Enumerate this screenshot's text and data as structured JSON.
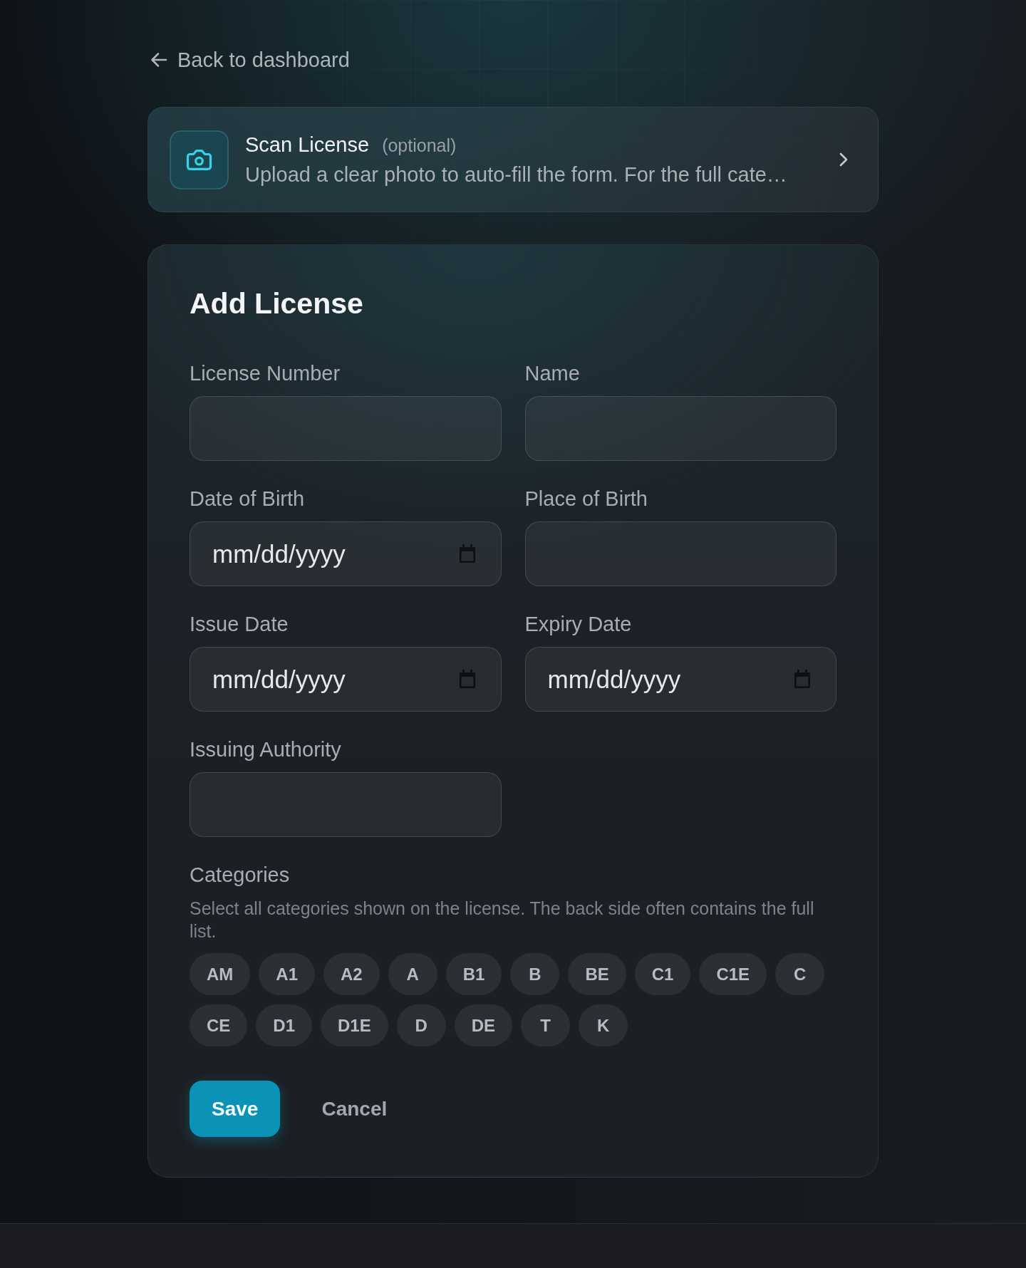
{
  "back_link": {
    "label": "Back to dashboard"
  },
  "scan_card": {
    "title": "Scan License",
    "tag": "(optional)",
    "description": "Upload a clear photo to auto-fill the form. For the full cate…"
  },
  "form": {
    "title": "Add License",
    "fields": [
      {
        "label": "License Number",
        "kind": "text"
      },
      {
        "label": "Name",
        "kind": "text"
      },
      {
        "label": "Date of Birth",
        "kind": "date",
        "placeholder": "mm/dd/yyyy"
      },
      {
        "label": "Place of Birth",
        "kind": "text"
      },
      {
        "label": "Issue Date",
        "kind": "date",
        "placeholder": "mm/dd/yyyy"
      },
      {
        "label": "Expiry Date",
        "kind": "date",
        "placeholder": "mm/dd/yyyy"
      },
      {
        "label": "Issuing Authority",
        "kind": "text"
      }
    ],
    "categories": {
      "label": "Categories",
      "hint": "Select all categories shown on the license. The back side often contains the full list.",
      "chips": [
        {
          "label": "AM",
          "selected": false
        },
        {
          "label": "A1",
          "selected": false
        },
        {
          "label": "A2",
          "selected": false
        },
        {
          "label": "A",
          "selected": false
        },
        {
          "label": "B1",
          "selected": false
        },
        {
          "label": "B",
          "selected": false
        },
        {
          "label": "BE",
          "selected": false
        },
        {
          "label": "C1",
          "selected": false
        },
        {
          "label": "C1E",
          "selected": false
        },
        {
          "label": "C",
          "selected": false
        },
        {
          "label": "CE",
          "selected": false
        },
        {
          "label": "D1",
          "selected": false
        },
        {
          "label": "D1E",
          "selected": false
        },
        {
          "label": "D",
          "selected": false
        },
        {
          "label": "DE",
          "selected": false
        },
        {
          "label": "T",
          "selected": false
        },
        {
          "label": "K",
          "selected": false
        }
      ]
    },
    "buttons": [
      {
        "label": "Save",
        "kind": "primary"
      },
      {
        "label": "Cancel",
        "kind": "secondary"
      }
    ]
  }
}
